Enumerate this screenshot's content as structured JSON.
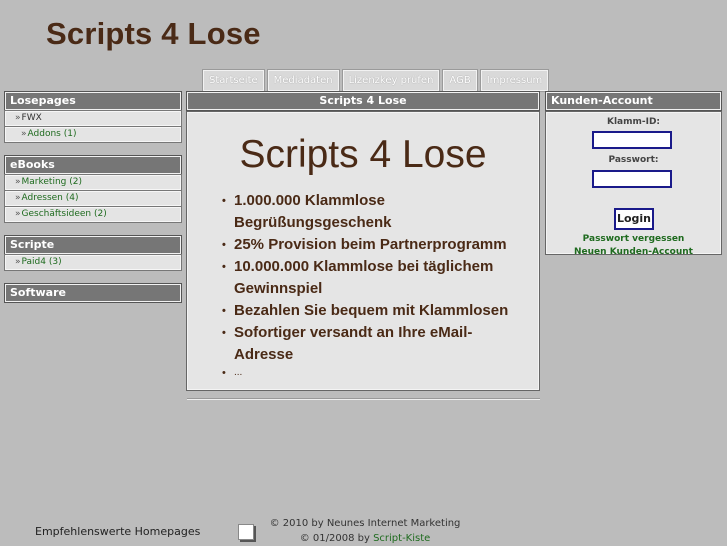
{
  "header": {
    "title": "Scripts 4 Lose"
  },
  "nav": {
    "tabs": [
      "Startseite",
      "Mediadaten",
      "Lizenzkey prüfen",
      "AGB",
      "Impressum"
    ]
  },
  "left": {
    "losepages": {
      "title": "Losepages",
      "items": [
        {
          "arrow": "»",
          "label": "FWX"
        },
        {
          "arrow": "»",
          "label": "Addons (1)"
        }
      ]
    },
    "ebooks": {
      "title": "eBooks",
      "items": [
        {
          "arrow": "»",
          "label": "Marketing (2)"
        },
        {
          "arrow": "»",
          "label": "Adressen (4)"
        },
        {
          "arrow": "»",
          "label": "Geschäftsideen (2)"
        }
      ]
    },
    "scripte": {
      "title": "Scripte",
      "items": [
        {
          "arrow": "»",
          "label": "Paid4 (3)"
        }
      ]
    },
    "software": {
      "title": "Software"
    }
  },
  "main": {
    "box_title": "Scripts 4 Lose",
    "hero": "Scripts 4 Lose",
    "bullet": "•",
    "features": [
      "1.000.000 Klammlose Begrüßungsgeschenk",
      "25% Provision beim Partnerprogramm",
      "10.000.000 Klammlose bei täglichem Gewinnspiel",
      "Bezahlen Sie bequem mit Klammlosen",
      "Sofortiger versandt an Ihre eMail-Adresse",
      "..."
    ]
  },
  "account": {
    "title": "Kunden-Account",
    "id_label": "Klamm-ID:",
    "password_label": "Passwort:",
    "login_label": "Login",
    "forgot_link": "Passwort vergessen",
    "new_account_link": "Neuen Kunden-Account"
  },
  "footer": {
    "recommended": "Empfehlenswerte Homepages",
    "copyright_1": "© 2010 by Neunes Internet Marketing",
    "copyright_2_prefix": "© 01/2008 by ",
    "copyright_2_link": "Script-Kiste"
  },
  "colors": {
    "background": "#bcbcbc",
    "title_brown": "#4a2a16",
    "box_header": "#767676",
    "link_green": "#1f6b1f",
    "input_border": "#1a1a8a"
  }
}
